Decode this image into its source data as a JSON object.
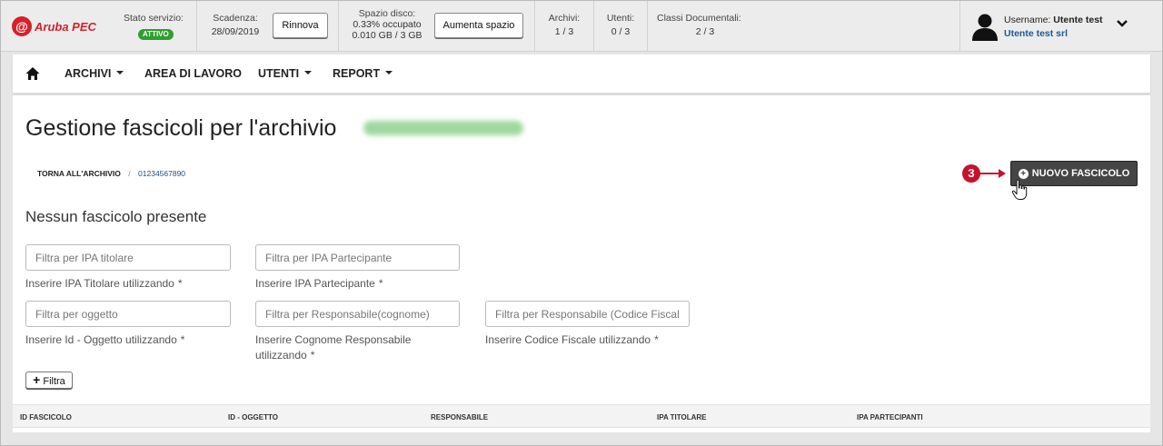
{
  "brand": {
    "logo_text": "Aruba PEC",
    "logo_mark": "@"
  },
  "status_bar": {
    "service_label": "Stato servizio:",
    "service_badge": "ATTIVO",
    "expiry_label": "Scadenza:",
    "expiry_value": "28/09/2019",
    "renew_label": "Rinnova",
    "disk_label": "Spazio disco:",
    "disk_used": "0.33% occupato",
    "disk_values": "0.010 GB / 3 GB",
    "disk_button_label": "Aumenta spazio",
    "archives_label": "Archivi:",
    "archives_value": "1 / 3",
    "users_label": "Utenti:",
    "users_value": "0 / 3",
    "doc_classes_label": "Classi Documentali:",
    "doc_classes_value": "2 / 3",
    "status_color": "#2f9e2f"
  },
  "user": {
    "username_label": "Username:",
    "username": "Utente test",
    "company": "Utente test srl",
    "avatar_icon": "user-silhouette-icon",
    "menu_icon": "chevron-down-icon"
  },
  "nav": {
    "home_icon": "home-icon",
    "items": [
      {
        "label": "ARCHIVI",
        "has_dropdown": true
      },
      {
        "label": "AREA DI LAVORO",
        "has_dropdown": false
      },
      {
        "label": "UTENTI",
        "has_dropdown": true
      },
      {
        "label": "REPORT",
        "has_dropdown": true
      }
    ]
  },
  "page": {
    "title": "Gestione fascicoli per l'archivio",
    "title_suffix_blurred": true,
    "breadcrumb": {
      "back_label": "TORNA ALL'ARCHIVIO",
      "separator": "/",
      "current": "01234567890"
    },
    "marker_number": "3",
    "marker_color": "#c8102e",
    "new_button_label": "NUOVO FASCICOLO",
    "subheading": "Nessun fascicolo presente"
  },
  "filters": {
    "ipa_titolare": {
      "placeholder": "Filtra per IPA titolare",
      "hint": "Inserire IPA Titolare utilizzando",
      "required": "*"
    },
    "ipa_partecipante": {
      "placeholder": "Filtra per IPA Partecipante",
      "hint": "Inserire IPA Partecipante",
      "required": "*"
    },
    "oggetto": {
      "placeholder": "Filtra per oggetto",
      "hint": "Inserire Id - Oggetto utilizzando",
      "required": "*"
    },
    "responsabile_cognome": {
      "placeholder": "Filtra per Responsabile(cognome)",
      "hint_line1": "Inserire Cognome Responsabile",
      "hint_line2": "utilizzando",
      "required": "*"
    },
    "responsabile_cf": {
      "placeholder": "Filtra per Responsabile (Codice Fiscale)",
      "hint": "Inserire Codice Fiscale utilizzando",
      "required": "*"
    },
    "submit_label": "Filtra",
    "submit_icon": "+"
  },
  "table": {
    "columns": [
      "ID FASCICOLO",
      "ID - OGGETTO",
      "RESPONSABILE",
      "IPA TITOLARE",
      "IPA PARTECIPANTI"
    ]
  }
}
